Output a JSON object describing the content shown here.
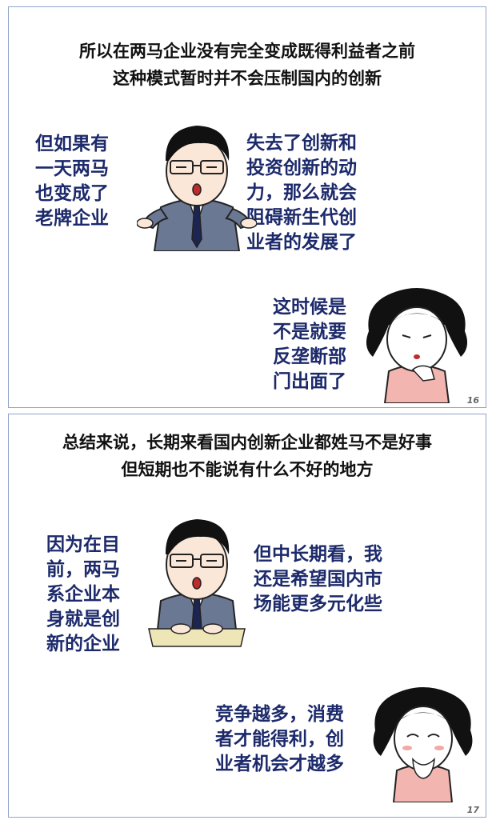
{
  "panels": [
    {
      "title_lines": [
        "所以在两马企业没有完全变成既得利益者之前",
        "这种模式暂时并不会压制国内的创新"
      ],
      "left_text": [
        "但如果有",
        "一天两马",
        "也变成了",
        "老牌企业"
      ],
      "right_text": [
        "失去了创新和",
        "投资创新的动",
        "力，那么就会",
        "阻碍新生代创",
        "业者的发展了"
      ],
      "woman_text": [
        "这时候是",
        "不是就要",
        "反垄断部",
        "门出面了"
      ],
      "page_number": "16"
    },
    {
      "title_lines": [
        "总结来说，长期来看国内创新企业都姓马不是好事",
        "但短期也不能说有什么不好的地方"
      ],
      "left_text": [
        "因为在目",
        "前，两马",
        "系企业本",
        "身就是创",
        "新的企业"
      ],
      "right_text": [
        "但中长期看，我",
        "还是希望国内市",
        "场能更多元化些"
      ],
      "woman_text": [
        "竞争越多，消费",
        "者才能得利，创",
        "业者机会才越多"
      ],
      "page_number": "17"
    }
  ],
  "colors": {
    "text": "#1c2a6b",
    "border": "#8fa3c8",
    "suit": "#6a7894",
    "sweater": "#f2b5b0"
  }
}
